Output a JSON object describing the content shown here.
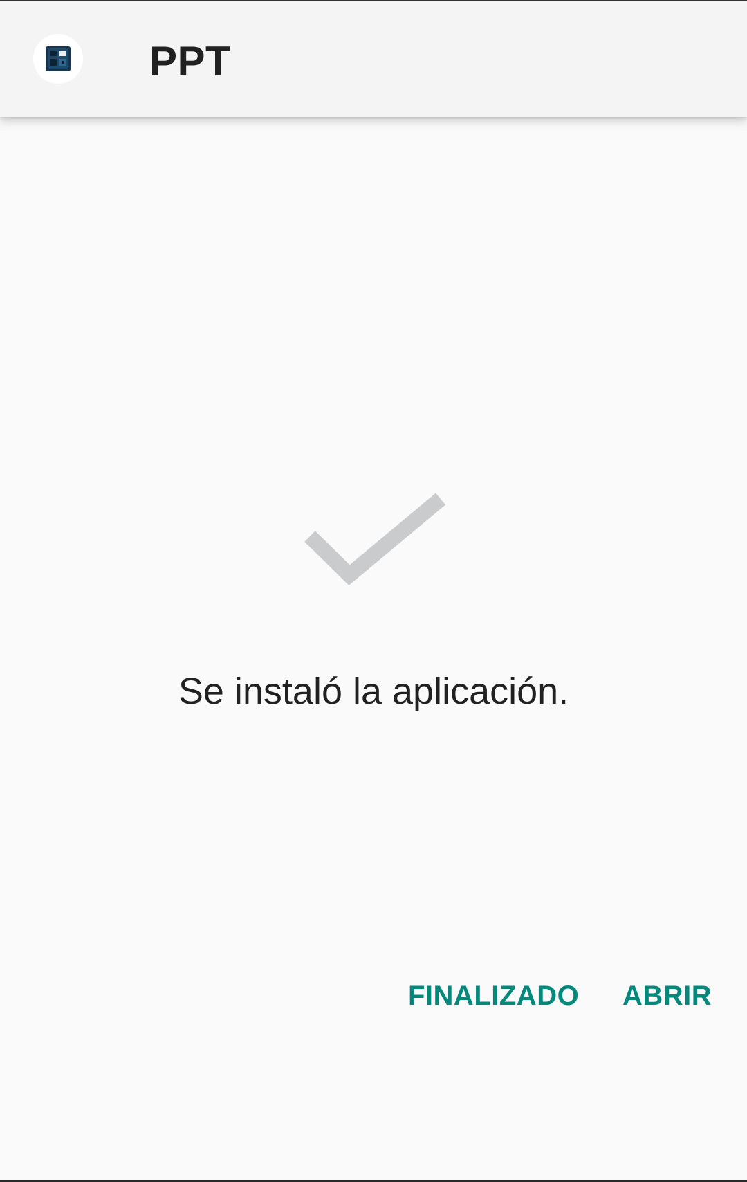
{
  "app": {
    "title": "PPT",
    "icon": "ppt-app-icon"
  },
  "main": {
    "status_icon": "checkmark-icon",
    "message": "Se instaló la aplicación."
  },
  "actions": {
    "done_label": "FINALIZADO",
    "open_label": "ABRIR"
  },
  "colors": {
    "accent": "#00897b",
    "check": "#c9cbcd",
    "background": "#fafafa",
    "app_bar": "#f4f4f4",
    "text": "#212121"
  }
}
